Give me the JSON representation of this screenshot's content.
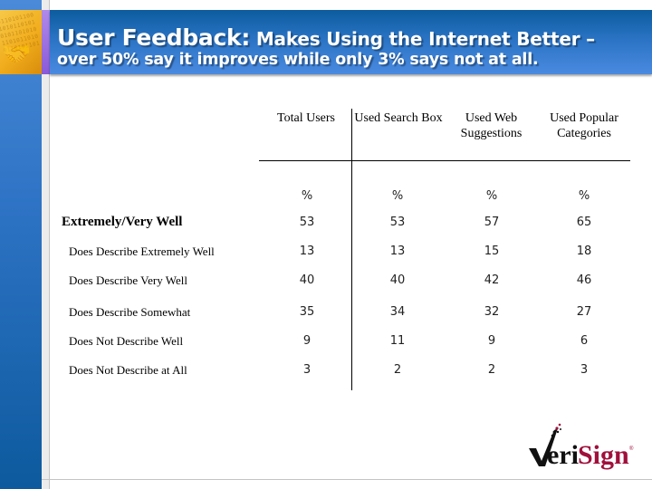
{
  "slide": {
    "title_main": "User Feedback:",
    "title_rest": " Makes Using the Internet Better –",
    "subtitle": "over 50% say it improves while only 3% says not at all."
  },
  "table": {
    "columns": [
      "Total Users",
      "Used Search Box",
      "Used Web Suggestions",
      "Used Popular Categories"
    ],
    "unit_row": [
      "%",
      "%",
      "%",
      "%"
    ],
    "rows": [
      {
        "label": "Extremely/Very Well",
        "bold": true,
        "values": [
          "53",
          "53",
          "57",
          "65"
        ]
      },
      {
        "label": "Does Describe Extremely Well",
        "bold": false,
        "values": [
          "13",
          "13",
          "15",
          "18"
        ]
      },
      {
        "label": "Does Describe Very Well",
        "bold": false,
        "values": [
          "40",
          "40",
          "42",
          "46"
        ]
      },
      {
        "label": "Does Describe Somewhat",
        "bold": false,
        "values": [
          "35",
          "34",
          "32",
          "27"
        ]
      },
      {
        "label": "Does Not Describe  Well",
        "bold": false,
        "values": [
          "9",
          "11",
          "9",
          "6"
        ]
      },
      {
        "label": "Does Not Describe at  All",
        "bold": false,
        "values": [
          "3",
          "2",
          "2",
          "3"
        ]
      }
    ]
  },
  "logo": {
    "text_black": "eri",
    "text_red": "Sign",
    "check_letter": "V",
    "registered": "®",
    "brand_color": "#a0103c"
  },
  "corner_tile": {
    "binary": "0110101100\n1010110101\n0101101010\n1101011010\n0110101101"
  }
}
